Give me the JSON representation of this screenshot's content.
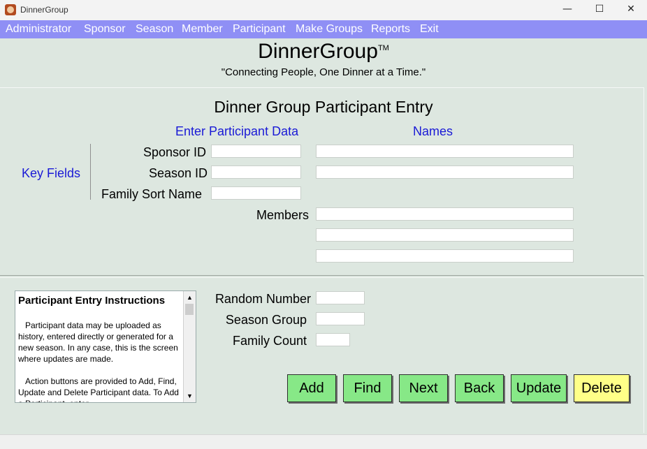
{
  "window": {
    "title": "DinnerGroup",
    "minimize": "—",
    "maximize": "☐",
    "close": "✕"
  },
  "menu": [
    "Administrator",
    "Sponsor",
    "Season",
    "Member",
    "Participant",
    "Make Groups",
    "Reports",
    "Exit"
  ],
  "brand": {
    "name": "DinnerGroup",
    "tm": "TM",
    "tagline": "\"Connecting People, One Dinner at a Time.\""
  },
  "form": {
    "title": "Dinner Group Participant Entry",
    "enter_header": "Enter Participant Data",
    "names_header": "Names",
    "key_fields": "Key Fields",
    "labels": {
      "sponsor_id": "Sponsor ID",
      "season_id": "Season ID",
      "family_sort_name": "Family Sort Name",
      "members": "Members",
      "random_number": "Random Number",
      "season_group": "Season Group",
      "family_count": "Family Count"
    },
    "values": {
      "sponsor_id": "",
      "season_id": "",
      "family_sort_name": "",
      "sponsor_name": "",
      "season_name": "",
      "member_1": "",
      "member_2": "",
      "member_3": "",
      "random_number": "",
      "season_group": "",
      "family_count": ""
    }
  },
  "instructions": {
    "title": "Participant Entry Instructions",
    "paragraphs": [
      "Participant data may be uploaded as history, entered directly or generated for a new season.  In any case, this is the screen where updates are made.",
      "Action buttons are provided to Add, Find, Update and Delete Participant data.  To Add a Participant, enter"
    ],
    "scroll_up": "▲",
    "scroll_down": "▼"
  },
  "buttons": {
    "add": "Add",
    "find": "Find",
    "next": "Next",
    "back": "Back",
    "update": "Update",
    "delete": "Delete"
  },
  "colors": {
    "menubar": "#8f8ff5",
    "background": "#dde7e0",
    "button_green": "#87e887",
    "button_yellow": "#ffff88",
    "label_blue": "#1a1ad6"
  }
}
